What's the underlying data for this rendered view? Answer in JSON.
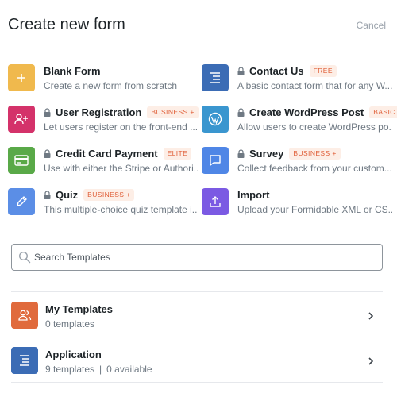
{
  "header": {
    "title": "Create new form",
    "cancel_label": "Cancel"
  },
  "templates": [
    {
      "name": "Blank Form",
      "desc": "Create a new form from scratch",
      "locked": false,
      "badge": "",
      "icon": "plus-icon",
      "color": "#f0b94d"
    },
    {
      "name": "Contact Us",
      "desc": "A basic contact form that for any W...",
      "locked": true,
      "badge": "FREE",
      "icon": "form-lines-icon",
      "color": "#3b6cb5"
    },
    {
      "name": "User Registration",
      "desc": "Let users register on the front-end ...",
      "locked": true,
      "badge": "BUSINESS +",
      "icon": "add-user-icon",
      "color": "#d4326a"
    },
    {
      "name": "Create WordPress Post",
      "desc": "Allow users to create WordPress po...",
      "locked": true,
      "badge": "BASIC +",
      "icon": "wordpress-icon",
      "color": "#3a96cf"
    },
    {
      "name": "Credit Card Payment",
      "desc": "Use with either the Stripe or Authori...",
      "locked": true,
      "badge": "ELITE",
      "icon": "credit-card-icon",
      "color": "#59a948"
    },
    {
      "name": "Survey",
      "desc": "Collect feedback from your custom...",
      "locked": true,
      "badge": "BUSINESS +",
      "icon": "chat-bubble-icon",
      "color": "#4f86e6"
    },
    {
      "name": "Quiz",
      "desc": "This multiple-choice quiz template i...",
      "locked": true,
      "badge": "BUSINESS +",
      "icon": "pencil-icon",
      "color": "#5b8ee6"
    },
    {
      "name": "Import",
      "desc": "Upload your Formidable XML or CS...",
      "locked": false,
      "badge": "",
      "icon": "upload-icon",
      "color": "#7b5ae3"
    }
  ],
  "search": {
    "placeholder": "Search Templates"
  },
  "categories": [
    {
      "name": "My Templates",
      "count": "0 templates",
      "available": "",
      "icon": "users-icon",
      "color": "#e06a3c"
    },
    {
      "name": "Application",
      "count": "9 templates",
      "separator": "|",
      "available": "0 available",
      "icon": "form-lines-icon",
      "color": "#3b6cb5"
    }
  ]
}
